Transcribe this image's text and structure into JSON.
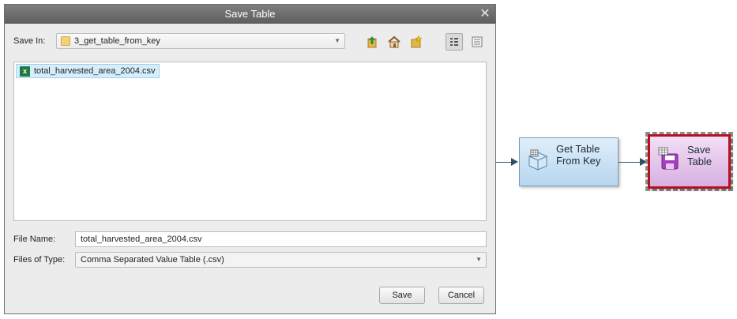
{
  "dialog": {
    "title": "Save Table",
    "save_in_label": "Save In:",
    "save_in_value": "3_get_table_from_key",
    "toolbar_icons": [
      "up-folder-icon",
      "home-icon",
      "new-folder-icon",
      "list-view-icon",
      "details-view-icon"
    ],
    "files": [
      {
        "name": "total_harvested_area_2004.csv",
        "icon": "excel-file-icon"
      }
    ],
    "file_name_label": "File Name:",
    "file_name_value": "total_harvested_area_2004.csv",
    "files_of_type_label": "Files of Type:",
    "files_of_type_value": "Comma Separated Value Table (.csv)",
    "save_button": "Save",
    "cancel_button": "Cancel"
  },
  "workflow": {
    "nodes": [
      {
        "label": "Get Table\nFrom Key",
        "icon": "table-cube-icon",
        "selected": false
      },
      {
        "label": "Save\nTable",
        "icon": "save-table-icon",
        "selected": true
      }
    ],
    "colors": {
      "selected_border": "#b3121e",
      "edge": "#2f4f63"
    }
  }
}
